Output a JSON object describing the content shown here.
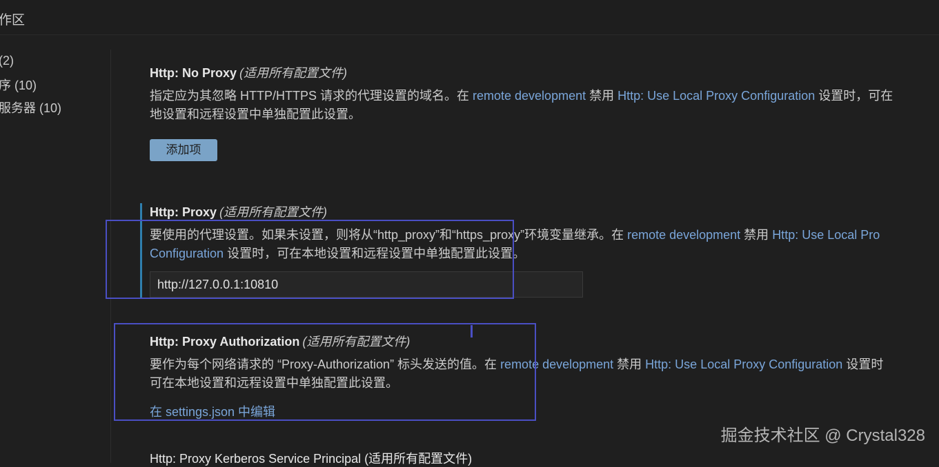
{
  "tab": {
    "label": "作区"
  },
  "toc": {
    "items": [
      {
        "label": "(2)"
      },
      {
        "label": "序 (10)"
      },
      {
        "label": "服务器 (10)"
      }
    ]
  },
  "settings": {
    "no_proxy": {
      "name": "Http: No Proxy",
      "scope": "(适用所有配置文件)",
      "desc_line1_a": "指定应为其忽略 HTTP/HTTPS 请求的代理设置的域名。在 ",
      "desc_link1": "remote development",
      "desc_line1_b": " 禁用 ",
      "desc_link2": "Http: Use Local Proxy Configuration",
      "desc_line1_c": " 设置时，可在",
      "desc_line2": "地设置和远程设置中单独配置此设置。",
      "add_button": "添加项"
    },
    "proxy": {
      "name": "Http: Proxy",
      "scope": "(适用所有配置文件)",
      "desc_line1_a": "要使用的代理设置。如果未设置，则将从“http_proxy”和“https_proxy”环境变量继承。在 ",
      "desc_link1": "remote development",
      "desc_line1_b": " 禁用 ",
      "desc_link2a": "Http: Use Local Pro",
      "desc_link2b": "Configuration",
      "desc_line2": " 设置时，可在本地设置和远程设置中单独配置此设置。",
      "value": "http://127.0.0.1:10810"
    },
    "proxy_auth": {
      "name": "Http: Proxy Authorization",
      "scope": "(适用所有配置文件)",
      "desc_line1_a": "要作为每个网络请求的 “Proxy-Authorization” 标头发送的值。在 ",
      "desc_link1": "remote development",
      "desc_line1_b": " 禁用 ",
      "desc_link2": "Http: Use Local Proxy Configuration",
      "desc_line1_c": " 设置时",
      "desc_line2": "可在本地设置和远程设置中单独配置此设置。",
      "edit_link": "在 settings.json 中编辑"
    },
    "next": {
      "title": "Http: Proxy Kerberos Service Principal (适用所有配置文件)"
    }
  },
  "watermark": "掘金技术社区 @ Crystal328",
  "colors": {
    "background": "#1f1f1f",
    "link": "#7aa6da",
    "button": "#7aa3c7",
    "modified_bar": "#2f7fae",
    "annotation": "#4a4fc4"
  }
}
